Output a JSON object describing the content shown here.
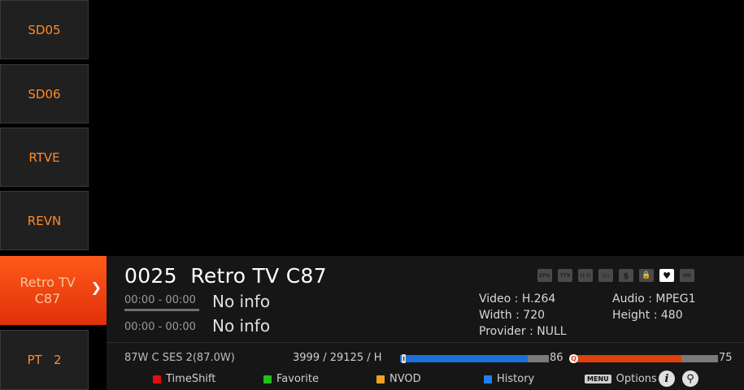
{
  "channels": [
    {
      "name": "SD05"
    },
    {
      "name": "SD06"
    },
    {
      "name": "RTVE"
    },
    {
      "name": "REVN"
    },
    {
      "name": "Retro TV C87"
    },
    {
      "name": "PT   2"
    }
  ],
  "info": {
    "channel_number": "0025",
    "channel_name": "Retro TV C87",
    "events": [
      {
        "time": "00:00 - 00:00",
        "title": "No info"
      },
      {
        "time": "00:00 - 00:00",
        "title": "No info"
      }
    ],
    "icons": [
      "EPG",
      "TTX",
      "((·))",
      "▭",
      "$",
      "🔒",
      "♥",
      "HD"
    ],
    "video": "Video : H.264",
    "audio": "Audio : MPEG1",
    "width": "Width : 720",
    "height": "Height : 480",
    "provider": "Provider : NULL",
    "satellite": "87W C SES 2(87.0W)",
    "transponder": "3999 / 29125 / H",
    "strength": {
      "marker": "I",
      "value": 86,
      "label": "86",
      "color": "#1a6fd8"
    },
    "quality": {
      "marker": "Q",
      "value": 75,
      "label": "75",
      "color": "#e0400a"
    }
  },
  "keys": {
    "red": {
      "label": "TimeShift",
      "color": "#e01010"
    },
    "green": {
      "label": "Favorite",
      "color": "#20c020"
    },
    "yellow": {
      "label": "NVOD",
      "color": "#f0a020"
    },
    "blue": {
      "label": "History",
      "color": "#2080f0"
    },
    "menu_badge": "MENU",
    "options": "Options",
    "info_icon": "i",
    "search_icon": "⚲"
  }
}
